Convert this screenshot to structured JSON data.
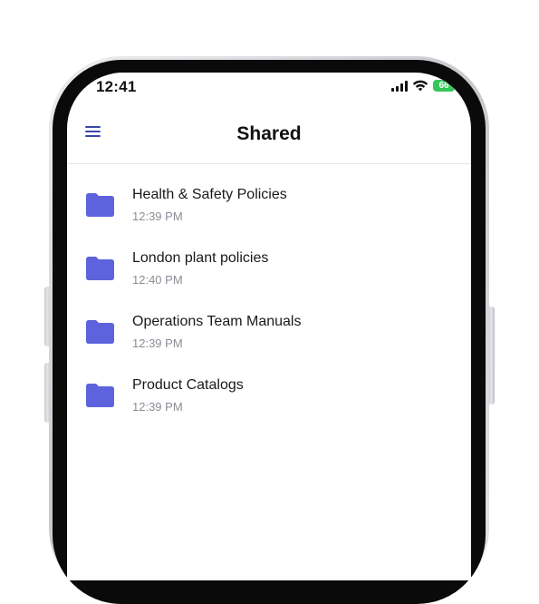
{
  "status_bar": {
    "time": "12:41",
    "battery": "66",
    "icons": [
      "signal-icon",
      "wifi-icon",
      "battery-icon"
    ]
  },
  "header": {
    "title": "Shared",
    "menu_icon": "hamburger-menu-icon"
  },
  "colors": {
    "accent": "#3a47a8",
    "folder": "#5d63dc",
    "battery": "#34c759",
    "subtext": "#8a8d96"
  },
  "folders": [
    {
      "name": "Health & Safety Policies",
      "time": "12:39 PM"
    },
    {
      "name": "London plant policies",
      "time": "12:40 PM"
    },
    {
      "name": "Operations Team Manuals",
      "time": "12:39 PM"
    },
    {
      "name": "Product Catalogs",
      "time": "12:39 PM"
    }
  ]
}
